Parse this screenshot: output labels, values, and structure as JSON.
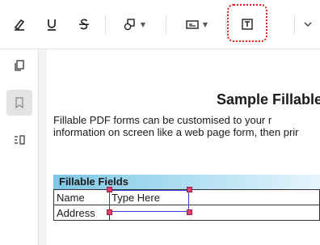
{
  "toolbar": {
    "tools": [
      {
        "name": "highlight-pen",
        "icon": "pen-icon"
      },
      {
        "name": "underline",
        "icon": "underline-icon"
      },
      {
        "name": "strikethrough",
        "icon": "strikethrough-icon"
      },
      {
        "name": "shapes",
        "icon": "shapes-icon",
        "has_dropdown": true
      },
      {
        "name": "stamp",
        "icon": "stamp-icon",
        "has_dropdown": true
      },
      {
        "name": "text-box",
        "icon": "text-box-icon",
        "highlighted": true
      },
      {
        "name": "more",
        "icon": "chevron-down-icon"
      }
    ],
    "highlight_color": "#e41c1c"
  },
  "sidebar": {
    "items": [
      {
        "name": "pages",
        "icon": "pages-icon",
        "active": false
      },
      {
        "name": "bookmarks",
        "icon": "bookmark-icon",
        "active": true
      },
      {
        "name": "outline",
        "icon": "outline-icon",
        "active": false
      }
    ]
  },
  "document": {
    "title": "Sample Fillable",
    "lines": [
      "Fillable PDF forms can be customised to your r",
      "information on screen like a web page form, then prir"
    ],
    "section_header": "Fillable Fields",
    "section_color": "#7fc7e6",
    "rows": [
      {
        "label": "Name",
        "value": "Type Here"
      },
      {
        "label": "Address",
        "value": ""
      }
    ],
    "selection_color": "#3a3fd6",
    "handle_color": "#e0406d"
  }
}
